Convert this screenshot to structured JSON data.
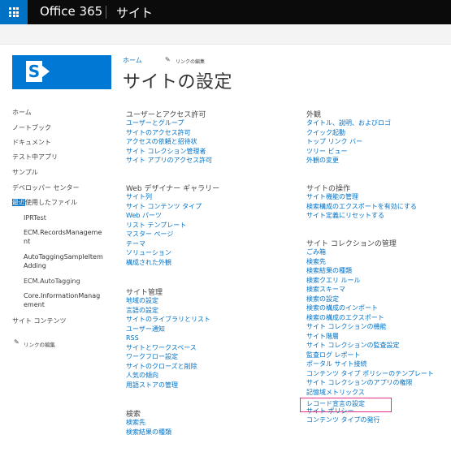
{
  "suite": {
    "brand": "Office 365",
    "app": "サイト"
  },
  "breadcrumb": {
    "home": "ホーム",
    "edit_links": "リンクの編集"
  },
  "page_title": "サイトの設定",
  "left_nav": {
    "items": [
      "ホーム",
      "ノートブック",
      "ドキュメント",
      "テスト中アプリ",
      "サンプル",
      "デベロッパー センター"
    ],
    "recent_selected": "最近",
    "recent_rest": "使用したファイル",
    "recent_items": [
      "IPRTest",
      "ECM.RecordsManagement",
      "AutoTaggingSampleItemAdding",
      "ECM.AutoTagging",
      "Core.InformationManagement"
    ],
    "site_contents": "サイト コンテンツ",
    "edit_links": "リンクの編集"
  },
  "sections": {
    "users": {
      "title": "ユーザーとアクセス許可",
      "links": [
        "ユーザーとグループ",
        "サイトのアクセス許可",
        "アクセスの依頼と招待状",
        "サイト コレクション管理者",
        "サイト アプリのアクセス許可"
      ]
    },
    "webdesigner": {
      "title": "Web デザイナー ギャラリー",
      "links": [
        "サイト列",
        "サイト コンテンツ タイプ",
        "Web パーツ",
        "リスト テンプレート",
        "マスター ページ",
        "テーマ",
        "ソリューション",
        "構成された外観"
      ]
    },
    "siteadmin": {
      "title": "サイト管理",
      "links": [
        "地域の設定",
        "言語の設定",
        "サイトのライブラリとリスト",
        "ユーザー通知",
        "RSS",
        "サイトとワークスペース",
        "ワークフロー設定",
        "サイトのクローズと削除",
        "人気の傾向",
        "用語ストアの管理"
      ]
    },
    "search": {
      "title": "検索",
      "links": [
        "検索先",
        "検索結果の種類"
      ]
    },
    "look": {
      "title": "外観",
      "links": [
        "タイトル、説明、およびロゴ",
        "クイック起動",
        "トップ リンク バー",
        "ツリー ビュー",
        "外観の変更"
      ]
    },
    "actions": {
      "title": "サイトの操作",
      "links": [
        "サイト機能の管理",
        "検索構成のエクスポートを有効にする",
        "サイト定義にリセットする"
      ]
    },
    "collection": {
      "title": "サイト コレクションの管理",
      "links": [
        "ごみ箱",
        "検索先",
        "検索結果の種類",
        "検索クエリ ルール",
        "検索スキーマ",
        "検索の設定",
        "検索の構成のインポート",
        "検索の構成のエクスポート",
        "サイト コレクションの機能",
        "サイト階層",
        "サイト コレクションの監査設定",
        "監査ログ レポート",
        "ポータル サイト接続",
        "コンテンツ タイプ ポリシーのテンプレート",
        "サイト コレクションのアプリの権限",
        "記憶域メトリックス",
        "レコード宣言の設定",
        "サイト ポリシー",
        "コンテンツ タイプの発行"
      ]
    }
  },
  "colors": {
    "link": "#0072c6",
    "brand": "#0078d4",
    "highlight": "#e62e8c",
    "suitebar": "#0b0b0b"
  }
}
